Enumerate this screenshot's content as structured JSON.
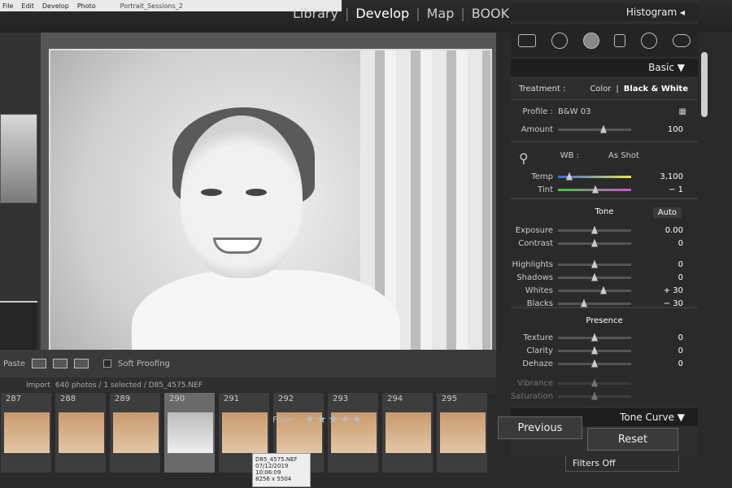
{
  "menubar": {
    "items": [
      "File",
      "Edit",
      "Develop",
      "Photo"
    ],
    "document": "Portrait_Sessions_2"
  },
  "modules": {
    "items": [
      "Library",
      "Develop",
      "Map",
      "BOOK"
    ],
    "active": "Develop"
  },
  "image_toolbar": {
    "soft_proofing": "Soft Proofing"
  },
  "filmstrip_header": {
    "import": "Import",
    "info": "640 photos / 1 selected / D85_4575.NEF",
    "paste": "Paste"
  },
  "filmstrip": {
    "filter_label": "Filter :",
    "filters_off": "Filters Off",
    "cells": [
      "287",
      "288",
      "289",
      "290",
      "291",
      "292",
      "293",
      "294",
      "295"
    ],
    "tooltip": {
      "file": "D85_4575.NEF",
      "date": "07/12/2019 10:06:09",
      "size": "8256 x 5504"
    }
  },
  "panel": {
    "histogram": "Histogram",
    "basic": "Basic",
    "treatment_label": "Treatment :",
    "treatment_color": "Color",
    "treatment_bw": "Black & White",
    "profile_label": "Profile :",
    "profile_value": "B&W 03",
    "amount_label": "Amount",
    "amount_value": "100",
    "wb_label": "WB :",
    "wb_value": "As Shot",
    "temp_label": "Temp",
    "temp_value": "3,100",
    "tint_label": "Tint",
    "tint_value": "− 1",
    "tone_title": "Tone",
    "auto": "Auto",
    "exposure_label": "Exposure",
    "exposure_value": "0.00",
    "contrast_label": "Contrast",
    "contrast_value": "0",
    "highlights_label": "Highlights",
    "highlights_value": "0",
    "shadows_label": "Shadows",
    "shadows_value": "0",
    "whites_label": "Whites",
    "whites_value": "+ 30",
    "blacks_label": "Blacks",
    "blacks_value": "− 30",
    "presence_title": "Presence",
    "texture_label": "Texture",
    "texture_value": "0",
    "clarity_label": "Clarity",
    "clarity_value": "0",
    "dehaze_label": "Dehaze",
    "dehaze_value": "0",
    "vibrance_label": "Vibrance",
    "saturation_label": "Saturation",
    "tone_curve": "Tone Curve",
    "previous": "Previous",
    "reset": "Reset"
  }
}
